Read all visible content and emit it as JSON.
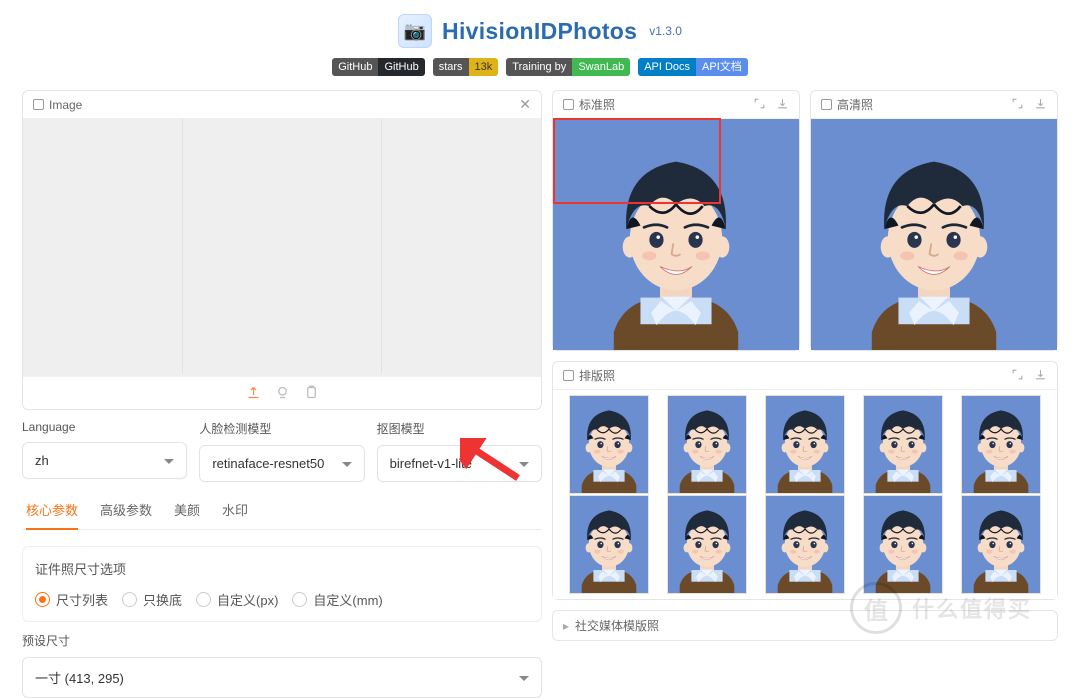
{
  "header": {
    "title": "HivisionIDPhotos",
    "version": "v1.3.0",
    "badges": [
      {
        "left": "GitHub",
        "right": "GitHub",
        "leftCls": "b-dark",
        "rightCls": "b-black"
      },
      {
        "left": "stars",
        "right": "13k",
        "leftCls": "b-dark",
        "rightCls": "b-yellow"
      },
      {
        "left": "Training by",
        "right": "SwanLab",
        "leftCls": "b-dark",
        "rightCls": "b-green"
      },
      {
        "left": "API Docs",
        "right": "API文档",
        "leftCls": "b-cyan",
        "rightCls": "b-lblue"
      }
    ]
  },
  "left": {
    "image_label": "Image",
    "fields": {
      "language": {
        "label": "Language",
        "value": "zh"
      },
      "face_model": {
        "label": "人脸检测模型",
        "value": "retinaface-resnet50"
      },
      "matting_model": {
        "label": "抠图模型",
        "value": "birefnet-v1-lite"
      }
    },
    "tabs": [
      "核心参数",
      "高级参数",
      "美颜",
      "水印"
    ],
    "active_tab": 0,
    "size_group": {
      "title": "证件照尺寸选项",
      "options": [
        "尺寸列表",
        "只换底",
        "自定义(px)",
        "自定义(mm)"
      ],
      "selected": 0
    },
    "preset_label": "预设尺寸",
    "preset_value": "一寸    (413, 295)"
  },
  "right": {
    "standard_label": "标准照",
    "hd_label": "高清照",
    "layout_label": "排版照",
    "social_label": "社交媒体模版照"
  },
  "watermark": {
    "circle": "值",
    "text": "什么值得买"
  },
  "colors": {
    "preview_bg": "#6a8ecf"
  }
}
